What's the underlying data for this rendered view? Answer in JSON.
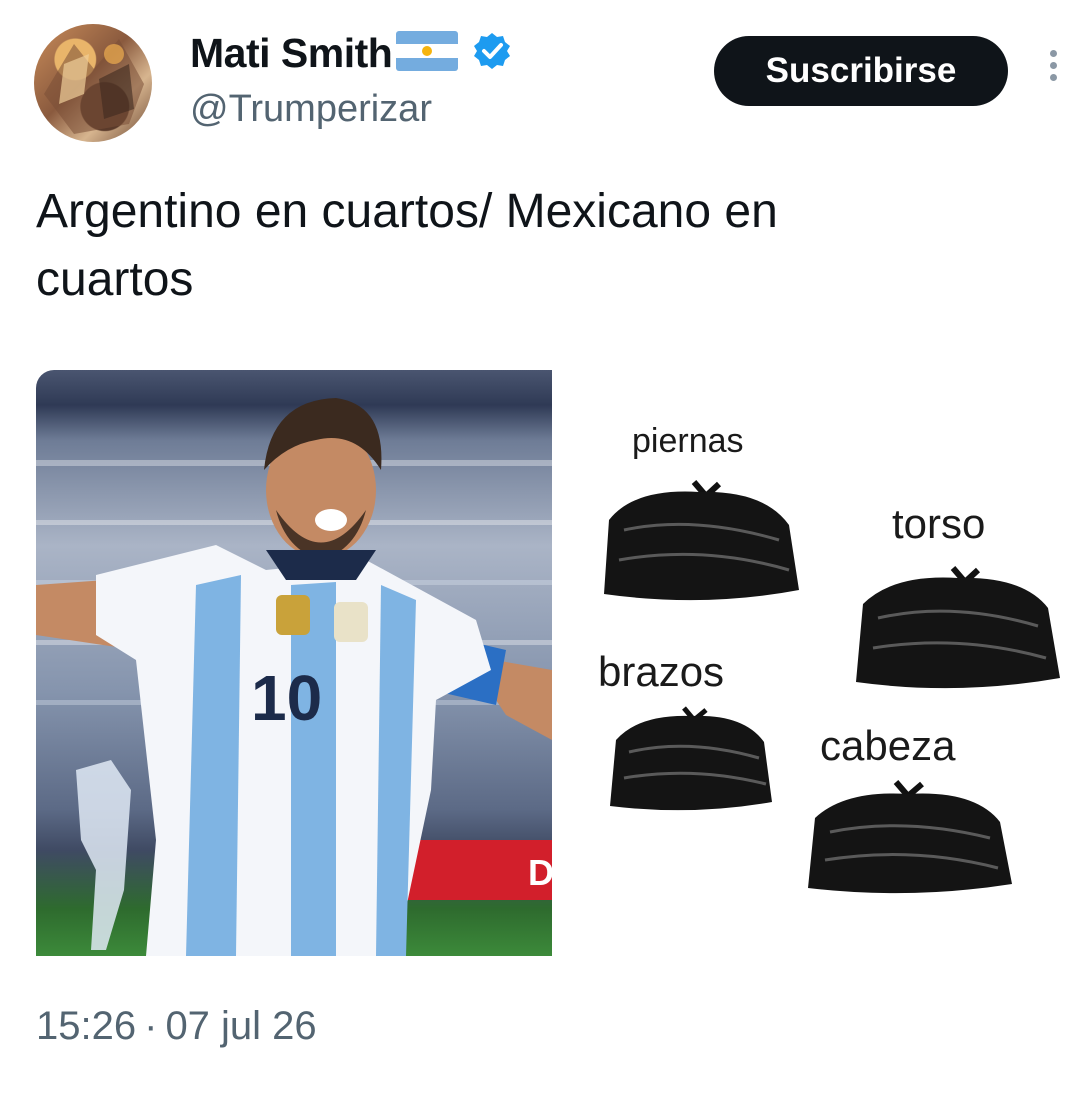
{
  "author": {
    "name": "Mati Smith",
    "handle": "@Trumperizar",
    "flag_icon": "argentina-flag-icon",
    "verified_icon": "verified-badge-icon"
  },
  "actions": {
    "subscribe_label": "Suscribirse",
    "more_icon": "more-vertical-icon"
  },
  "tweet": {
    "text_line1": "Argentino en cuartos/ Mexicano en",
    "text_line2": "cuartos",
    "timestamp_time": "15:26",
    "timestamp_sep": "·",
    "timestamp_date": "07 jul 26"
  },
  "media": {
    "meme_labels": {
      "piernas": "piernas",
      "torso": "torso",
      "brazos": "brazos",
      "cabeza": "cabeza"
    },
    "jersey_number": "10",
    "ad_board_text": "D"
  },
  "colors": {
    "text_primary": "#0f1419",
    "text_secondary": "#536471",
    "verified_blue": "#1d9bf0",
    "flag_blue": "#74acdf",
    "button_bg": "#0f1419",
    "button_text": "#ffffff"
  }
}
